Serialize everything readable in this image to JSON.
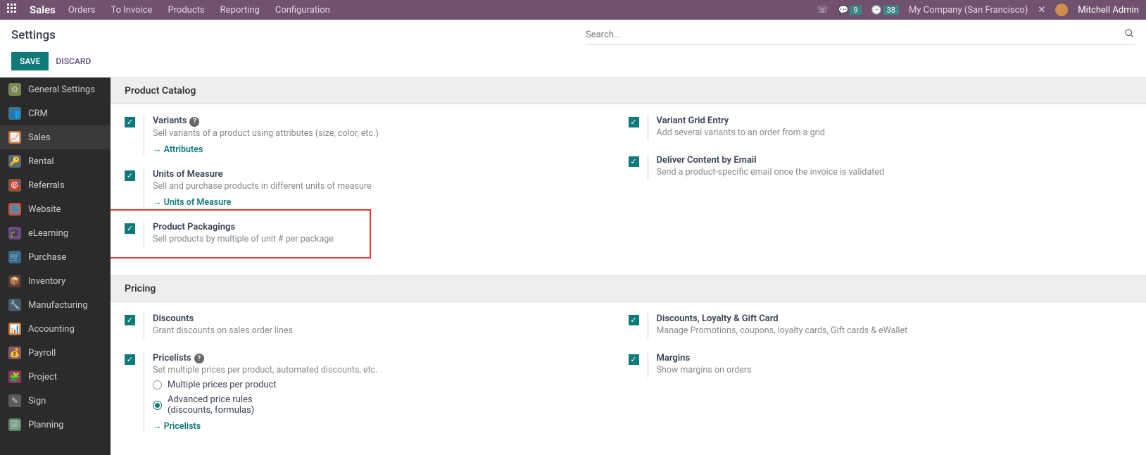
{
  "topbar": {
    "brand": "Sales",
    "nav": [
      "Orders",
      "To Invoice",
      "Products",
      "Reporting",
      "Configuration"
    ],
    "chat_badge": "9",
    "clock_badge": "38",
    "company": "My Company (San Francisco)",
    "user": "Mitchell Admin"
  },
  "header": {
    "title": "Settings",
    "search_placeholder": "Search...",
    "save": "SAVE",
    "discard": "DISCARD"
  },
  "sidebar": [
    {
      "label": "General Settings",
      "icon": "⚙",
      "bg": "#7a8b52"
    },
    {
      "label": "CRM",
      "icon": "👥",
      "bg": "#3b7a8b"
    },
    {
      "label": "Sales",
      "icon": "📈",
      "bg": "#c97a3b",
      "active": true
    },
    {
      "label": "Rental",
      "icon": "🔑",
      "bg": "#5b6b7a"
    },
    {
      "label": "Referrals",
      "icon": "🎯",
      "bg": "#8b5b3b"
    },
    {
      "label": "Website",
      "icon": "🌐",
      "bg": "#c9533b"
    },
    {
      "label": "eLearning",
      "icon": "🎓",
      "bg": "#6b4b8b"
    },
    {
      "label": "Purchase",
      "icon": "🛒",
      "bg": "#3b6b8b"
    },
    {
      "label": "Inventory",
      "icon": "📦",
      "bg": "#5b3b3b"
    },
    {
      "label": "Manufacturing",
      "icon": "🔧",
      "bg": "#4b5b6b"
    },
    {
      "label": "Accounting",
      "icon": "📊",
      "bg": "#c97a3b"
    },
    {
      "label": "Payroll",
      "icon": "💰",
      "bg": "#8b5b6b"
    },
    {
      "label": "Project",
      "icon": "🧩",
      "bg": "#8b3b5b"
    },
    {
      "label": "Sign",
      "icon": "✎",
      "bg": "#5b5b5b"
    },
    {
      "label": "Planning",
      "icon": "🗓",
      "bg": "#5b8b6b"
    }
  ],
  "sections": {
    "product_catalog": {
      "title": "Product Catalog",
      "left": [
        {
          "title": "Variants",
          "desc": "Sell variants of a product using attributes (size, color, etc.)",
          "help": true,
          "link": "Attributes"
        },
        {
          "title": "Units of Measure",
          "desc": "Sell and purchase products in different units of measure",
          "link": "Units of Measure"
        },
        {
          "title": "Product Packagings",
          "desc": "Sell products by multiple of unit # per package",
          "highlight": true
        }
      ],
      "right": [
        {
          "title": "Variant Grid Entry",
          "desc": "Add several variants to an order from a grid"
        },
        {
          "title": "Deliver Content by Email",
          "desc": "Send a product-specific email once the invoice is validated"
        }
      ]
    },
    "pricing": {
      "title": "Pricing",
      "left": [
        {
          "title": "Discounts",
          "desc": "Grant discounts on sales order lines"
        },
        {
          "title": "Pricelists",
          "desc": "Set multiple prices per product, automated discounts, etc.",
          "help": true,
          "radios": [
            {
              "label": "Multiple prices per product",
              "checked": false
            },
            {
              "label": "Advanced price rules",
              "sublabel": "(discounts, formulas)",
              "checked": true
            }
          ],
          "link": "Pricelists"
        }
      ],
      "right": [
        {
          "title": "Discounts, Loyalty & Gift Card",
          "desc": "Manage Promotions, coupons, loyalty cards, Gift cards & eWallet"
        },
        {
          "title": "Margins",
          "desc": "Show margins on orders"
        }
      ]
    }
  }
}
